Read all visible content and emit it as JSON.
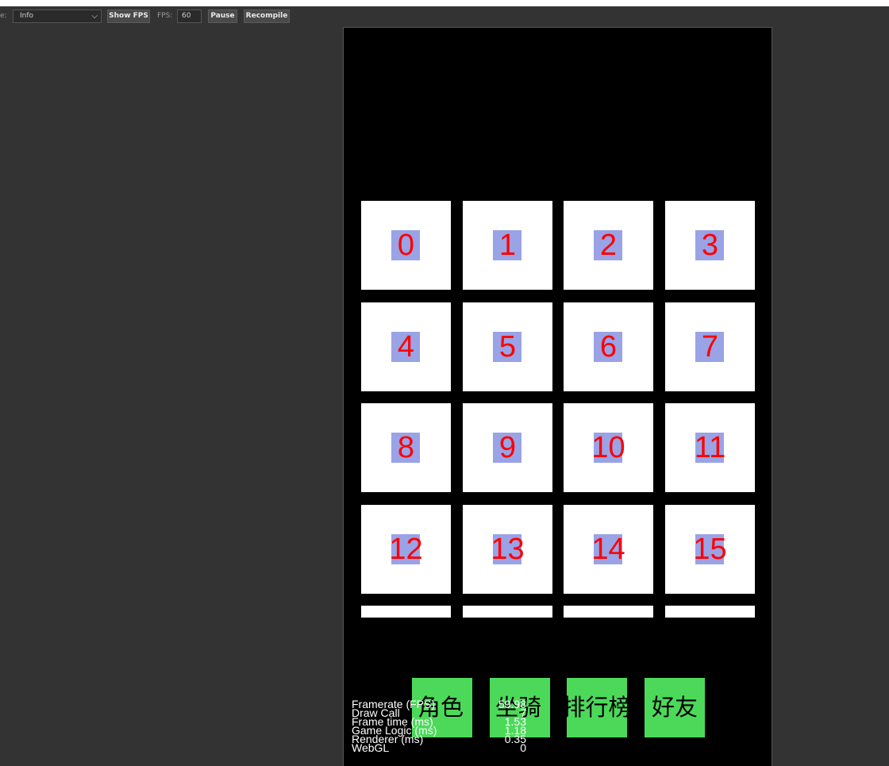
{
  "toolbar": {
    "mode_label": "e:",
    "mode_value": "Info",
    "show_fps_label": "Show FPS",
    "fps_label": "FPS:",
    "fps_value": "60",
    "pause_label": "Pause",
    "recompile_label": "Recompile",
    "chevron_icon": "chevron-down-icon"
  },
  "grid": {
    "cells": [
      "0",
      "1",
      "2",
      "3",
      "4",
      "5",
      "6",
      "7",
      "8",
      "9",
      "10",
      "11",
      "12",
      "13",
      "14",
      "15"
    ],
    "cell_bg": "#ffffff",
    "highlight_color": "#99a3e6",
    "number_color": "#ff0000"
  },
  "nav": {
    "buttons": [
      "角色",
      "坐骑",
      "排行榜",
      "好友"
    ],
    "button_color": "#4cd95a"
  },
  "stats": {
    "rows": [
      {
        "label": "Framerate (FPS)",
        "value": "59.98"
      },
      {
        "label": "Draw Call",
        "value": "7"
      },
      {
        "label": "Frame time (ms)",
        "value": "1.53"
      },
      {
        "label": "Game Logic (ms)",
        "value": "1.18"
      },
      {
        "label": "Renderer (ms)",
        "value": "0.35"
      },
      {
        "label": "WebGL",
        "value": "0"
      }
    ]
  }
}
